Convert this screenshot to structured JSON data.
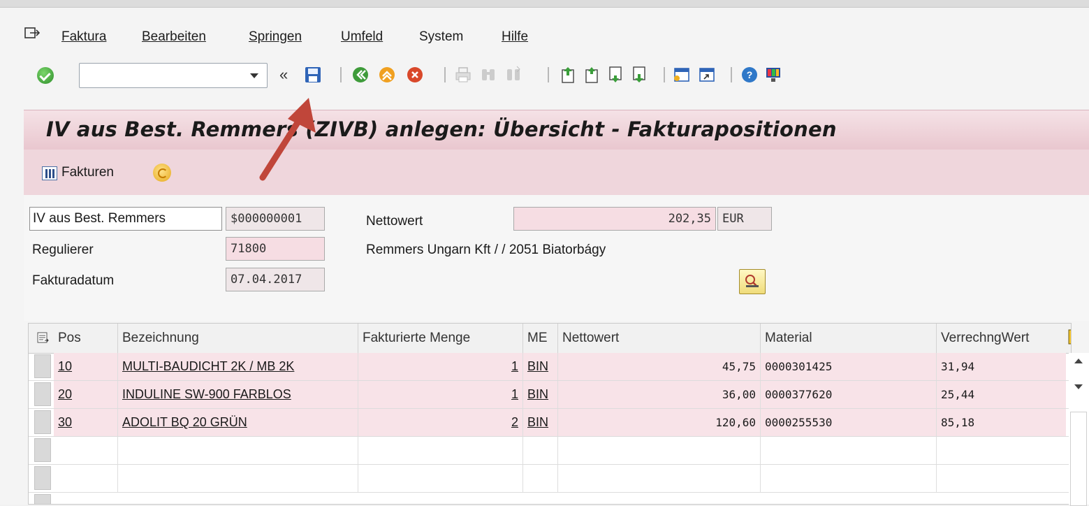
{
  "menu": {
    "items": [
      {
        "label": "Faktura"
      },
      {
        "label": "Bearbeiten"
      },
      {
        "label": "Springen"
      },
      {
        "label": "Umfeld"
      },
      {
        "label": "System"
      },
      {
        "label": "Hilfe"
      }
    ]
  },
  "toolbar": {
    "command_value": "",
    "dbl_chevron": "«",
    "icons": [
      "enter-icon",
      "save-icon",
      "back-icon",
      "exit-icon",
      "cancel-icon",
      "print-icon",
      "find-icon",
      "find-next-icon",
      "first-page-icon",
      "previous-page-icon",
      "next-page-icon",
      "last-page-icon",
      "create-session-icon",
      "shortcut-icon",
      "help-icon",
      "customize-layout-icon"
    ]
  },
  "title": "IV aus Best. Remmers (ZIVB) anlegen: Übersicht - Fakturapositionen",
  "app_toolbar": {
    "fakturen_label": "Fakturen"
  },
  "header": {
    "billing_type": "IV aus Best. Remmers",
    "document_number": "$000000001",
    "nettowert_label": "Nettowert",
    "nettowert_value": "202,35",
    "currency": "EUR",
    "regulierer_label": "Regulierer",
    "regulierer_value": "71800",
    "regulierer_name": "Remmers Ungarn Kft / / 2051 Biatorbágy",
    "fakturadatum_label": "Fakturadatum",
    "fakturadatum_value": "07.04.2017"
  },
  "table": {
    "columns": [
      "Pos",
      "Bezeichnung",
      "Fakturierte Menge",
      "ME",
      "Nettowert",
      "Material",
      "VerrechngWert"
    ],
    "rows": [
      {
        "pos": "10",
        "bezeichnung": "MULTI-BAUDICHT 2K / MB 2K",
        "menge": "1",
        "me": "BIN",
        "nettowert": "45,75",
        "material": "0000301425",
        "verrechng": "31,94"
      },
      {
        "pos": "20",
        "bezeichnung": "INDULINE SW-900 FARBLOS",
        "menge": "1",
        "me": "BIN",
        "nettowert": "36,00",
        "material": "0000377620",
        "verrechng": "25,44"
      },
      {
        "pos": "30",
        "bezeichnung": "ADOLIT BQ 20 GRÜN",
        "menge": "2",
        "me": "BIN",
        "nettowert": "120,60",
        "material": "0000255530",
        "verrechng": "85,18"
      }
    ]
  },
  "colors": {
    "title_bg": "#efd6dc",
    "row_highlight": "#f8e3e8",
    "annotation_arrow": "#c0463a"
  }
}
